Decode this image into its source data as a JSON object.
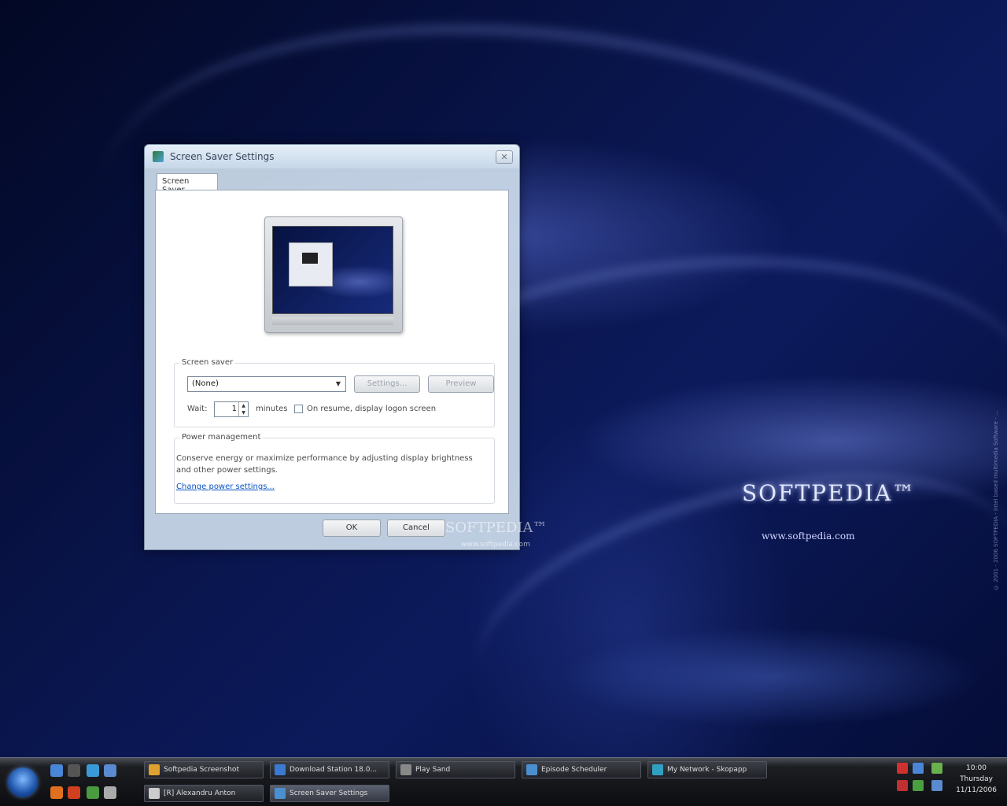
{
  "desktop": {
    "wallpaper_logo": "SOFTPEDIA™",
    "wallpaper_url": "www.softpedia.com",
    "wallpaper_side_text": "© 2001 - 2006 SOFTPEDIA - Intel based multimedia Software - ...",
    "watermark": "SOFTPEDIA™",
    "watermark_url": "www.softpedia.com"
  },
  "dialog": {
    "title": "Screen Saver Settings",
    "close_label": "✕",
    "tab_label": "Screen Saver",
    "screen_saver": {
      "group_label": "Screen saver",
      "selected": "(None)",
      "settings_label": "Settings...",
      "preview_label": "Preview",
      "wait_label": "Wait:",
      "wait_value": "1",
      "minutes_label": "minutes",
      "resume_label": "On resume, display logon screen",
      "resume_checked": false
    },
    "power": {
      "group_label": "Power management",
      "description": "Conserve energy or maximize performance by adjusting display brightness and other power settings.",
      "link": "Change power settings..."
    },
    "ok_label": "OK",
    "cancel_label": "Cancel"
  },
  "taskbar": {
    "tasks_row1": [
      {
        "label": "Softpedia Screenshot",
        "color": "#e0a030"
      },
      {
        "label": "Download Station 18.0...",
        "color": "#3a7ad0"
      },
      {
        "label": "Play Sand",
        "color": "#888888"
      },
      {
        "label": "Episode Scheduler",
        "color": "#4a90d0"
      },
      {
        "label": "My Network - Skopapp",
        "color": "#30a0c0"
      }
    ],
    "tasks_row2": [
      {
        "label": "[R] Alexandru Anton",
        "color": "#cccccc"
      },
      {
        "label": "Screen Saver Settings",
        "color": "#4a90d0"
      }
    ],
    "clock_time": "10:00",
    "clock_day": "Thursday",
    "clock_date": "11/11/2006"
  }
}
